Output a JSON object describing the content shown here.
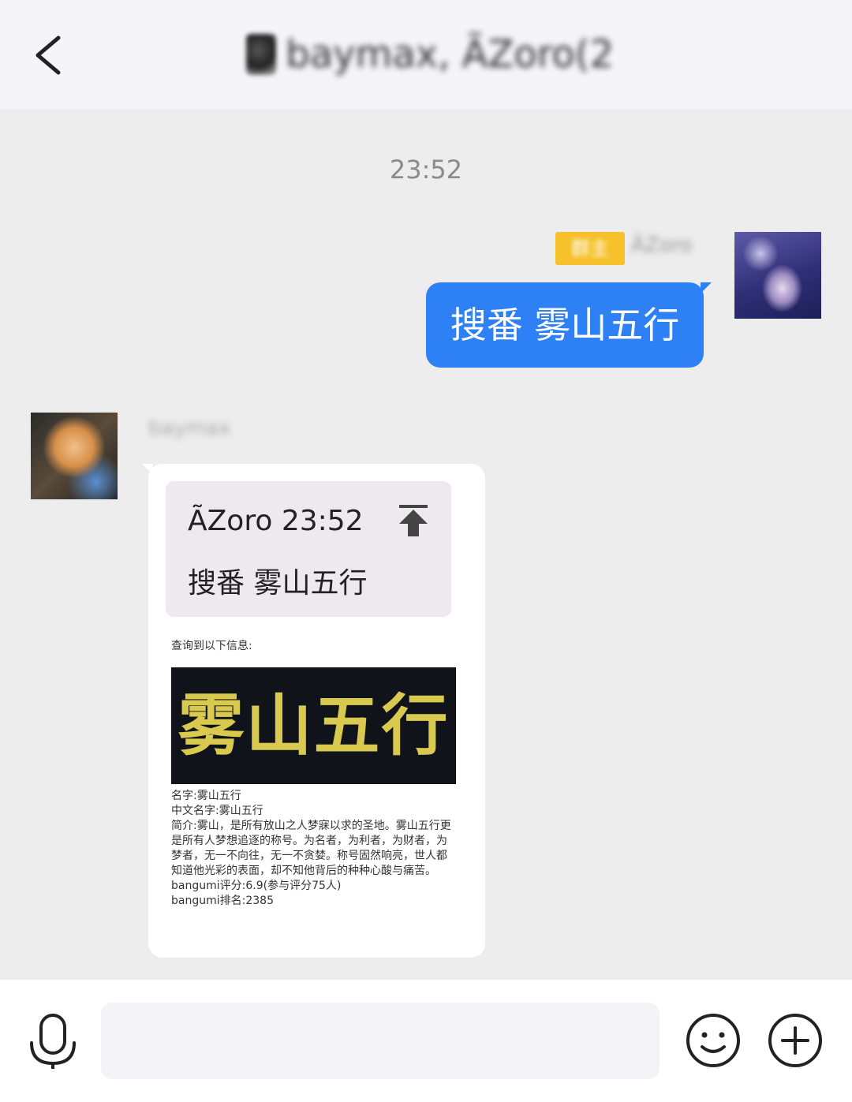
{
  "header": {
    "title": "baymax, ÃZoro(2"
  },
  "chat": {
    "timestamp": "23:52",
    "outgoing": {
      "badge": "群主",
      "sender_name": "ÃZoro",
      "message": "搜番 雾山五行"
    },
    "incoming": {
      "sender_name": "baymax",
      "quote": {
        "sender": "ÃZoro",
        "time": "23:52",
        "text": "搜番 雾山五行"
      },
      "intro": "查询到以下信息:",
      "poster_title": "雾山五行",
      "info": {
        "name": "名字:雾山五行",
        "cn_name": "中文名字:雾山五行",
        "summary": "简介:雾山，是所有放山之人梦寐以求的圣地。雾山五行更是所有人梦想追逐的称号。为名者，为利者，为财者，为梦者，无一不向往，无一不贪婪。称号固然响亮，世人都知道他光彩的表面，却不知他背后的种种心酸与痛苦。",
        "score": "bangumi评分:6.9(参与评分75人)",
        "rank": "bangumi排名:2385"
      }
    }
  },
  "input": {
    "value": "",
    "placeholder": ""
  },
  "colors": {
    "outgoing_bubble": "#2d81f5",
    "badge": "#f6c12b",
    "background": "#ededed",
    "poster_text": "#d9c94e"
  },
  "icons": [
    "back-arrow-icon",
    "jump-to-message-icon",
    "microphone-icon",
    "smiley-icon",
    "plus-circle-icon"
  ]
}
